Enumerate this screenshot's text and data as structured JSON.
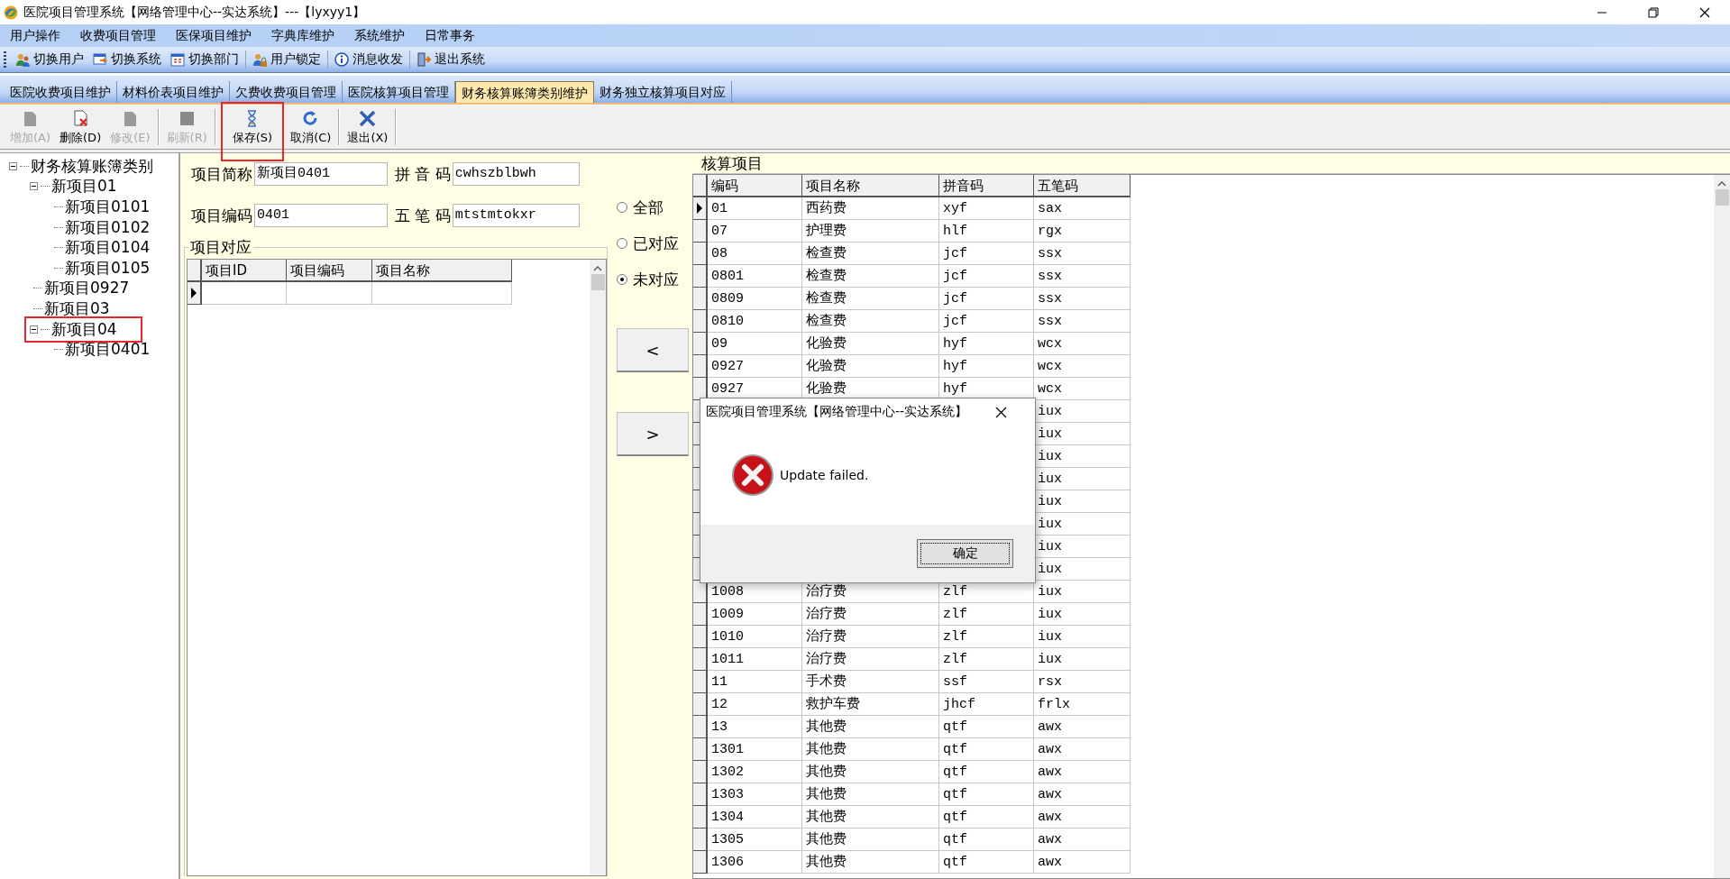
{
  "window": {
    "title": "医院项目管理系统【网络管理中心--实达系统】---【lyxyy1】"
  },
  "menu": [
    "用户操作",
    "收费项目管理",
    "医保项目维护",
    "字典库维护",
    "系统维护",
    "日常事务"
  ],
  "toolbar": [
    "切换用户",
    "切换系统",
    "切换部门",
    "用户锁定",
    "消息收发",
    "退出系统"
  ],
  "tabs": [
    {
      "label": "医院收费项目维护",
      "selected": false
    },
    {
      "label": "材料价表项目维护",
      "selected": false
    },
    {
      "label": "欠费收费项目管理",
      "selected": false
    },
    {
      "label": "医院核算项目管理",
      "selected": false
    },
    {
      "label": "财务核算账簿类别维护",
      "selected": true
    },
    {
      "label": "财务独立核算项目对应",
      "selected": false
    }
  ],
  "actions": [
    {
      "label": "增加(A)",
      "disabled": true,
      "highlighted": false
    },
    {
      "label": "删除(D)",
      "disabled": false,
      "highlighted": false
    },
    {
      "label": "修改(E)",
      "disabled": true,
      "highlighted": false
    },
    {
      "label": "刷新(R)",
      "disabled": true,
      "highlighted": false
    },
    {
      "label": "保存(S)",
      "disabled": false,
      "highlighted": true
    },
    {
      "label": "取消(C)",
      "disabled": false,
      "highlighted": false
    },
    {
      "label": "退出(X)",
      "disabled": false,
      "highlighted": false
    }
  ],
  "tree": {
    "label": "财务核算账簿类别",
    "expanded": true,
    "highlighted": false,
    "children": [
      {
        "label": "新项目01",
        "expanded": true,
        "highlighted": false,
        "children": [
          {
            "label": "新项目0101",
            "highlighted": false
          },
          {
            "label": "新项目0102",
            "highlighted": false
          },
          {
            "label": "新项目0104",
            "highlighted": false
          },
          {
            "label": "新项目0105",
            "highlighted": false
          }
        ]
      },
      {
        "label": "新项目0927",
        "highlighted": false
      },
      {
        "label": "新项目03",
        "highlighted": false
      },
      {
        "label": "新项目04",
        "expanded": true,
        "highlighted": true,
        "children": [
          {
            "label": "新项目0401",
            "highlighted": false
          }
        ]
      }
    ]
  },
  "form": {
    "fields": [
      {
        "label": "项目简称",
        "value": "新项目0401"
      },
      {
        "label": "拼 音 码",
        "value": "cwhszblbwh"
      },
      {
        "label": "项目编码",
        "value": "0401"
      },
      {
        "label": "五 笔 码",
        "value": "mtstmtokxr"
      }
    ],
    "filters": [
      {
        "label": "全部",
        "selected": false
      },
      {
        "label": "已对应",
        "selected": false
      },
      {
        "label": "未对应",
        "selected": true
      }
    ],
    "move_buttons": [
      "<",
      ">"
    ]
  },
  "mapping": {
    "title": "项目对应",
    "columns": [
      "项目ID",
      "项目编码",
      "项目名称"
    ],
    "rows": [
      {
        "selected": true
      }
    ]
  },
  "accounts": {
    "title": "核算项目",
    "columns": [
      "编码",
      "项目名称",
      "拼音码",
      "五笔码"
    ],
    "rows": [
      {
        "code": "01",
        "name": "西药费",
        "pinyin": "xyf",
        "wubi": "sax",
        "selected": true
      },
      {
        "code": "07",
        "name": "护理费",
        "pinyin": "hlf",
        "wubi": "rgx",
        "selected": false
      },
      {
        "code": "08",
        "name": "检查费",
        "pinyin": "jcf",
        "wubi": "ssx",
        "selected": false
      },
      {
        "code": "0801",
        "name": "检查费",
        "pinyin": "jcf",
        "wubi": "ssx",
        "selected": false
      },
      {
        "code": "0809",
        "name": "检查费",
        "pinyin": "jcf",
        "wubi": "ssx",
        "selected": false
      },
      {
        "code": "0810",
        "name": "检查费",
        "pinyin": "jcf",
        "wubi": "ssx",
        "selected": false
      },
      {
        "code": "09",
        "name": "化验费",
        "pinyin": "hyf",
        "wubi": "wcx",
        "selected": false
      },
      {
        "code": "0927",
        "name": "化验费",
        "pinyin": "hyf",
        "wubi": "wcx",
        "selected": false
      },
      {
        "code": "0927",
        "name": "化验费",
        "pinyin": "hyf",
        "wubi": "wcx",
        "selected": false
      },
      {
        "wubi": "iux",
        "selected": false
      },
      {
        "wubi": "iux",
        "selected": false
      },
      {
        "wubi": "iux",
        "selected": false
      },
      {
        "wubi": "iux",
        "selected": false
      },
      {
        "wubi": "iux",
        "selected": false
      },
      {
        "wubi": "iux",
        "selected": false
      },
      {
        "wubi": "iux",
        "selected": false
      },
      {
        "wubi": "iux",
        "selected": false
      },
      {
        "code": "1008",
        "name": "治疗费",
        "pinyin": "zlf",
        "wubi": "iux",
        "selected": false
      },
      {
        "code": "1009",
        "name": "治疗费",
        "pinyin": "zlf",
        "wubi": "iux",
        "selected": false
      },
      {
        "code": "1010",
        "name": "治疗费",
        "pinyin": "zlf",
        "wubi": "iux",
        "selected": false
      },
      {
        "code": "1011",
        "name": "治疗费",
        "pinyin": "zlf",
        "wubi": "iux",
        "selected": false
      },
      {
        "code": "11",
        "name": "手术费",
        "pinyin": "ssf",
        "wubi": "rsx",
        "selected": false
      },
      {
        "code": "12",
        "name": "救护车费",
        "pinyin": "jhcf",
        "wubi": "frlx",
        "selected": false
      },
      {
        "code": "13",
        "name": "其他费",
        "pinyin": "qtf",
        "wubi": "awx",
        "selected": false
      },
      {
        "code": "1301",
        "name": "其他费",
        "pinyin": "qtf",
        "wubi": "awx",
        "selected": false
      },
      {
        "code": "1302",
        "name": "其他费",
        "pinyin": "qtf",
        "wubi": "awx",
        "selected": false
      },
      {
        "code": "1303",
        "name": "其他费",
        "pinyin": "qtf",
        "wubi": "awx",
        "selected": false
      },
      {
        "code": "1304",
        "name": "其他费",
        "pinyin": "qtf",
        "wubi": "awx",
        "selected": false
      },
      {
        "code": "1305",
        "name": "其他费",
        "pinyin": "qtf",
        "wubi": "awx",
        "selected": false
      },
      {
        "code": "1306",
        "name": "其他费",
        "pinyin": "qtf",
        "wubi": "awx",
        "selected": false
      }
    ]
  },
  "dialog": {
    "title": "医院项目管理系统【网络管理中心--实达系统】",
    "message": "Update failed.",
    "button": "确定"
  }
}
